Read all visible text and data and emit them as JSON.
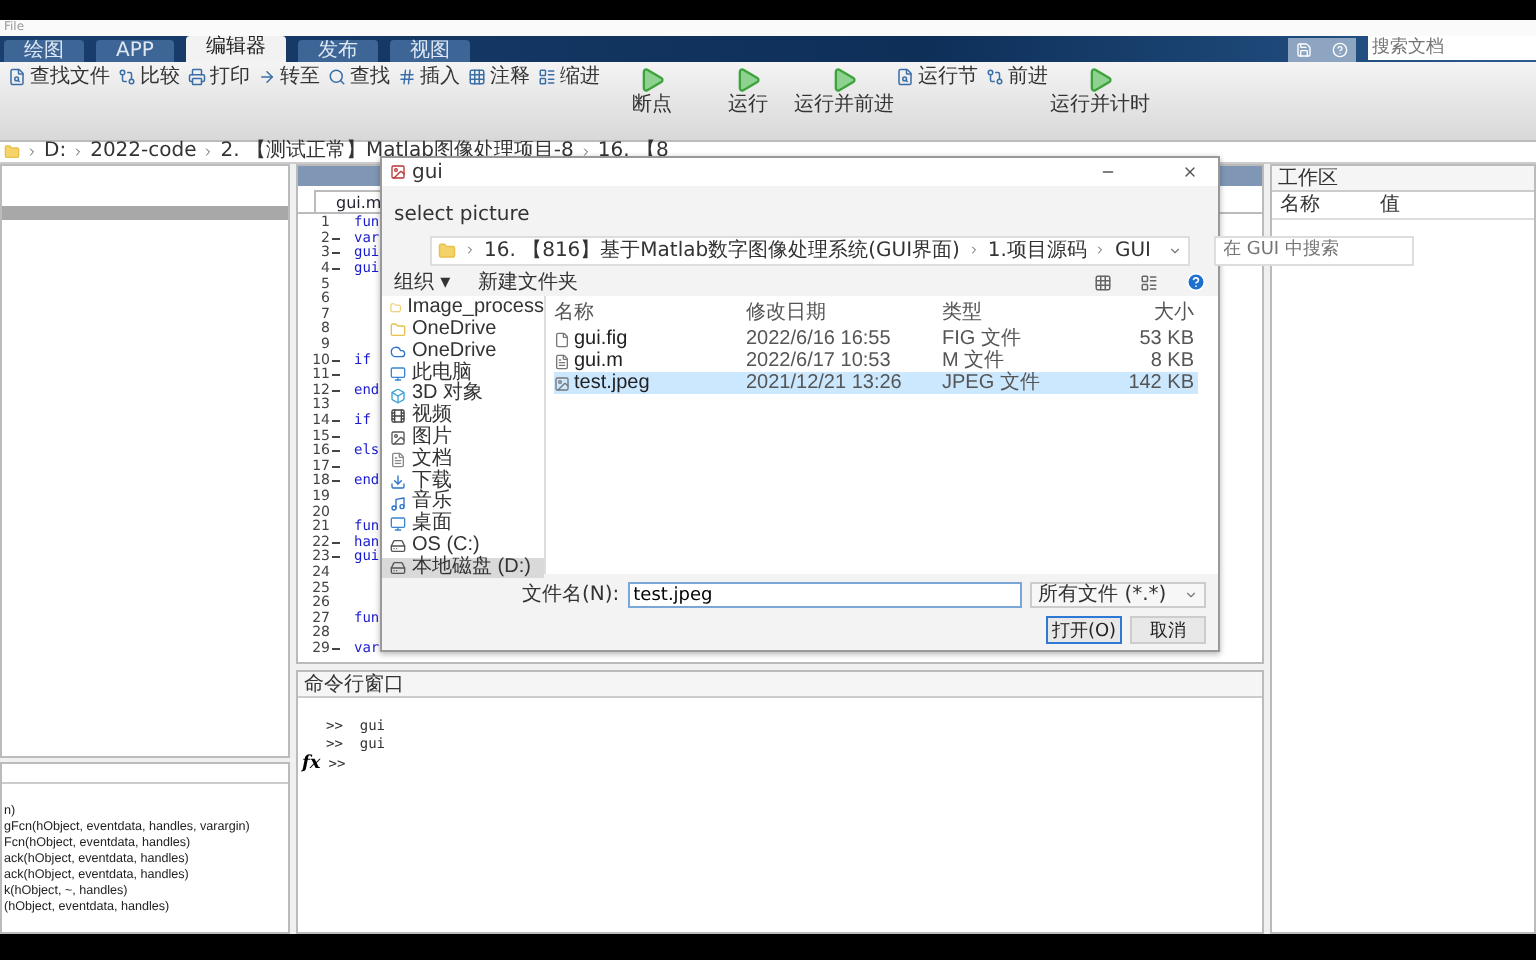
{
  "app_title": "File",
  "tabs": [
    {
      "label": "绘图",
      "selected": false
    },
    {
      "label": "APP",
      "selected": false
    },
    {
      "label": "编辑器",
      "selected": true
    },
    {
      "label": "发布",
      "selected": false
    },
    {
      "label": "视图",
      "selected": false
    }
  ],
  "search": {
    "placeholder": "搜索文档"
  },
  "ribbon": [
    {
      "kind": "small",
      "label": "查找文件"
    },
    {
      "kind": "small",
      "label": "比较"
    },
    {
      "kind": "small",
      "label": "打印"
    },
    {
      "kind": "small",
      "label": "转至"
    },
    {
      "kind": "small",
      "label": "查找"
    },
    {
      "kind": "small",
      "label": "插入"
    },
    {
      "kind": "small",
      "label": "注释"
    },
    {
      "kind": "small",
      "label": "缩进"
    },
    {
      "kind": "large",
      "label": "断点"
    },
    {
      "kind": "large",
      "label": "运行"
    },
    {
      "kind": "large",
      "label": "运行并前进"
    },
    {
      "kind": "small",
      "label": "运行节"
    },
    {
      "kind": "small",
      "label": "前进"
    },
    {
      "kind": "large",
      "label": "运行并计时"
    }
  ],
  "breadcrumb": [
    "D:",
    "2022-code",
    "2. 【测试正常】Matlab图像处理项目-8",
    "16. 【8"
  ],
  "function_list": [
    "n)",
    "gFcn(hObject, eventdata, handles, varargin)",
    "Fcn(hObject, eventdata, handles)",
    "ack(hObject, eventdata, handles)",
    "ack(hObject, eventdata, handles)",
    "k(hObject, ~, handles)",
    "(hObject, eventdata, handles)"
  ],
  "editor": {
    "file_tab": "gui.m",
    "lines": [
      {
        "number": "1",
        "code": "fun",
        "executable": false
      },
      {
        "number": "2",
        "code": "var",
        "executable": true
      },
      {
        "number": "3",
        "code": "gui",
        "executable": true
      },
      {
        "number": "4",
        "code": "gui",
        "executable": true
      },
      {
        "number": "5",
        "executable": false
      },
      {
        "number": "6",
        "executable": false
      },
      {
        "number": "7",
        "executable": false
      },
      {
        "number": "8",
        "executable": false
      },
      {
        "number": "9",
        "executable": false
      },
      {
        "number": "10",
        "code": "if",
        "executable": true
      },
      {
        "number": "11",
        "executable": true
      },
      {
        "number": "12",
        "code": "end",
        "executable": true
      },
      {
        "number": "13",
        "executable": false
      },
      {
        "number": "14",
        "code": "if",
        "executable": true
      },
      {
        "number": "15",
        "executable": true
      },
      {
        "number": "16",
        "code": "els",
        "executable": true
      },
      {
        "number": "17",
        "executable": true
      },
      {
        "number": "18",
        "code": "end",
        "executable": true
      },
      {
        "number": "19",
        "executable": false
      },
      {
        "number": "20",
        "executable": false
      },
      {
        "number": "21",
        "code": "fun",
        "executable": false
      },
      {
        "number": "22",
        "code": "han",
        "executable": true
      },
      {
        "number": "23",
        "code": "gui",
        "executable": true
      },
      {
        "number": "24",
        "executable": false
      },
      {
        "number": "25",
        "executable": false
      },
      {
        "number": "26",
        "executable": false
      },
      {
        "number": "27",
        "code": "fun",
        "executable": false
      },
      {
        "number": "28",
        "executable": false
      },
      {
        "number": "29",
        "code": "var",
        "executable": true
      }
    ]
  },
  "command_window": {
    "title": "命令行窗口",
    "lines": [
      ">>  gui",
      ">>  gui"
    ],
    "fx_label": "fx",
    "prompt": ">>"
  },
  "workspace": {
    "title": "工作区",
    "columns": [
      "名称",
      "值"
    ]
  },
  "dialog": {
    "title": "gui",
    "subtitle": "select picture",
    "path": [
      "16. 【816】基于Matlab数字图像处理系统(GUI界面)",
      "1.项目源码",
      "GUI"
    ],
    "search": {
      "placeholder": "在 GUI 中搜索"
    },
    "toolbar": [
      "组织 ▾",
      "新建文件夹"
    ],
    "nav": [
      {
        "label": "Image_process",
        "kind": "folder",
        "selected": false
      },
      {
        "label": "OneDrive",
        "kind": "folder",
        "selected": false
      },
      {
        "label": "OneDrive",
        "kind": "cloud",
        "selected": false
      },
      {
        "label": "此电脑",
        "kind": "pc",
        "selected": false
      },
      {
        "label": "3D 对象",
        "kind": "cube",
        "selected": false
      },
      {
        "label": "视频",
        "kind": "video",
        "selected": false
      },
      {
        "label": "图片",
        "kind": "image",
        "selected": false
      },
      {
        "label": "文档",
        "kind": "doc",
        "selected": false
      },
      {
        "label": "下载",
        "kind": "download",
        "selected": false
      },
      {
        "label": "音乐",
        "kind": "music",
        "selected": false
      },
      {
        "label": "桌面",
        "kind": "desktop",
        "selected": false
      },
      {
        "label": "OS (C:)",
        "kind": "drive",
        "selected": false
      },
      {
        "label": "本地磁盘 (D:)",
        "kind": "drive",
        "selected": true
      }
    ],
    "columns": [
      "名称",
      "修改日期",
      "类型",
      "大小"
    ],
    "files": [
      {
        "name": "gui.fig",
        "date": "2022/6/16 16:55",
        "type": "FIG 文件",
        "size": "53 KB",
        "kind": "file",
        "selected": false
      },
      {
        "name": "gui.m",
        "date": "2022/6/17 10:53",
        "type": "M 文件",
        "size": "8 KB",
        "kind": "script",
        "selected": false
      },
      {
        "name": "test.jpeg",
        "date": "2021/12/21 13:26",
        "type": "JPEG 文件",
        "size": "142 KB",
        "kind": "image",
        "selected": true
      }
    ],
    "filename_label": "文件名(N):",
    "filename": "test.jpeg",
    "filter": "所有文件 (*.*)",
    "buttons": [
      "打开(O)",
      "取消"
    ]
  }
}
